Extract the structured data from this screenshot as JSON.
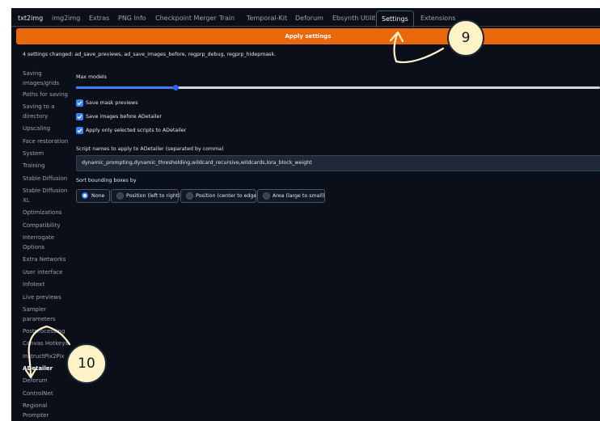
{
  "tabs": [
    "txt2img",
    "img2img",
    "Extras",
    "PNG Info",
    "Checkpoint Merger",
    "Train",
    "Temporal-Kit",
    "Deforum",
    "Ebsynth Utility",
    "Settings",
    "Extensions"
  ],
  "active_tab": "Settings",
  "apply_button": "Apply settings",
  "changed_notice": "4 settings changed: ad_save_previews, ad_save_images_before, regprp_debug, regprp_hidepmask.",
  "sidebar": [
    "Saving images/grids",
    "Paths for saving",
    "Saving to a directory",
    "Upscaling",
    "Face restoration",
    "System",
    "Training",
    "Stable Diffusion",
    "Stable Diffusion XL",
    "Optimizations",
    "Compatibility",
    "Interrogate Options",
    "Extra Networks",
    "User interface",
    "Infotext",
    "Live previews",
    "Sampler parameters",
    "Postprocessing",
    "Canvas Hotkeys",
    "InstructPix2Pix",
    "ADetailer",
    "Deforum",
    "ControlNet",
    "Regional Prompter"
  ],
  "sidebar_active": "ADetailer",
  "max_models": {
    "label": "Max models",
    "value_fraction": 0.19
  },
  "checkboxes": [
    {
      "label": "Save mask previews",
      "checked": true
    },
    {
      "label": "Save images before ADetailer",
      "checked": true
    },
    {
      "label": "Apply only selected scripts to ADetailer",
      "checked": true
    }
  ],
  "script_names": {
    "label": "Script names to apply to ADetailer (separated by comma)",
    "value": "dynamic_prompting,dynamic_thresholding,wildcard_recursive,wildcards,lora_block_weight"
  },
  "sort_bbox": {
    "label": "Sort bounding boxes by",
    "options": [
      "None",
      "Position (left to right)",
      "Position (center to edge)",
      "Area (large to small)"
    ],
    "selected": "None"
  },
  "markers": [
    "9",
    "10"
  ],
  "colors": {
    "accent": "#ea680c",
    "background": "#0b0f19",
    "checkbox": "#3b82f6",
    "marker_fill": "#fef3c7"
  }
}
